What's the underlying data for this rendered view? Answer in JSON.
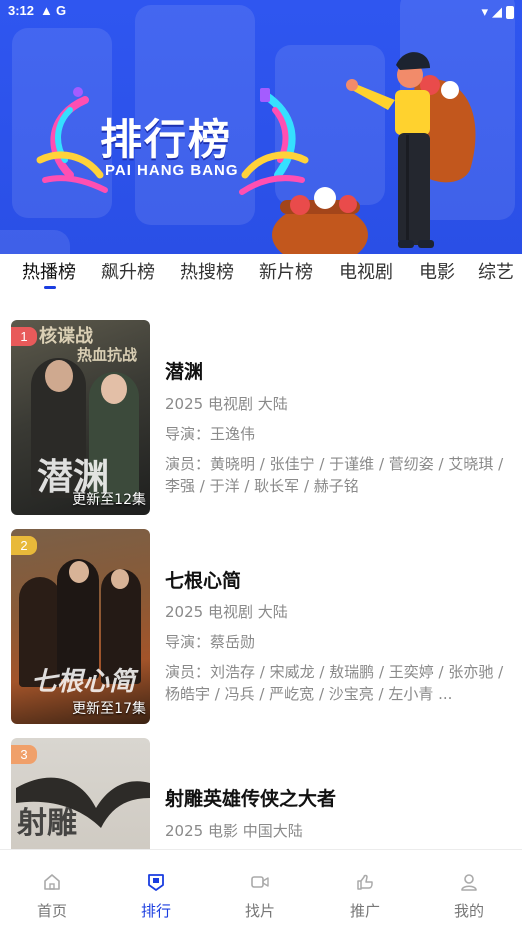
{
  "status_bar": {
    "time": "3:12",
    "g_label": "G"
  },
  "banner": {
    "title": "排行榜",
    "subtitle": "PAI HANG BANG"
  },
  "tabs": [
    "热播榜",
    "飙升榜",
    "热搜榜",
    "新片榜",
    "电视剧",
    "电影",
    "综艺"
  ],
  "active_tab": "热播榜",
  "items": [
    {
      "rank": "1",
      "rank_color": "#e85a5a",
      "title": "潜渊",
      "meta": "2025 电视剧 大陆",
      "director": "导演：王逸伟",
      "cast": "演员：黄晓明 / 张佳宁 / 于谨维 / 菅纫姿 / 艾晓琪 / 李强 / 于洋 / 耿长军 / 赫子铭",
      "update": "更新至12集",
      "poster_top_text": "核谍战",
      "poster_sub_text": "热血抗战",
      "poster_title": "潜渊"
    },
    {
      "rank": "2",
      "rank_color": "#e8b93a",
      "title": "七根心简",
      "meta": "2025 电视剧 大陆",
      "director": "导演：蔡岳勋",
      "cast": "演员：刘浩存 / 宋威龙 / 敖瑞鹏 / 王奕婷 / 张亦驰 / 杨皓宇 / 冯兵 / 严屹宽 / 沙宝亮 / 左小青 ...",
      "update": "更新至17集",
      "poster_title": "七根心简"
    },
    {
      "rank": "3",
      "rank_color": "#f0a06a",
      "title": "射雕英雄传侠之大者",
      "meta": "2025 电影 中国大陆",
      "poster_title": "射雕"
    }
  ],
  "nav": [
    {
      "label": "首页",
      "icon": "home-icon"
    },
    {
      "label": "排行",
      "icon": "ranking-icon"
    },
    {
      "label": "找片",
      "icon": "video-icon"
    },
    {
      "label": "推广",
      "icon": "promote-icon"
    },
    {
      "label": "我的",
      "icon": "profile-icon"
    }
  ],
  "active_nav": "排行",
  "colors": {
    "accent": "#1a3de0",
    "banner": "#2f56f0"
  }
}
